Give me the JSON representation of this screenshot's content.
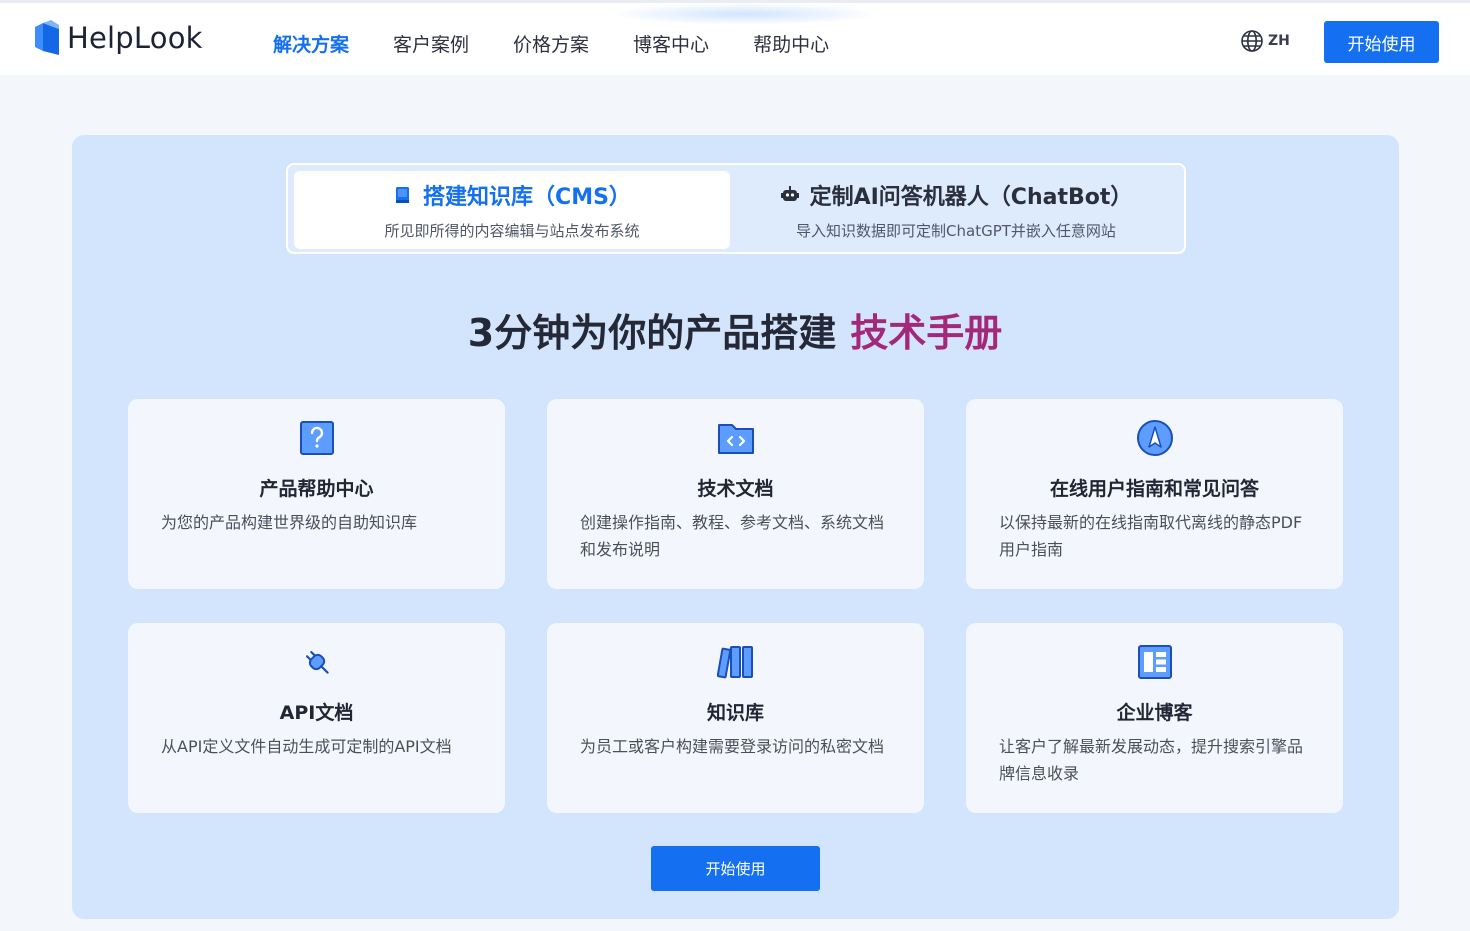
{
  "header": {
    "logo_text": "HelpLook",
    "nav": [
      {
        "label": "解决方案",
        "active": true
      },
      {
        "label": "客户案例",
        "active": false
      },
      {
        "label": "价格方案",
        "active": false
      },
      {
        "label": "博客中心",
        "active": false
      },
      {
        "label": "帮助中心",
        "active": false
      }
    ],
    "lang_label": "ZH",
    "cta_label": "开始使用"
  },
  "tabs": [
    {
      "title": "搭建知识库（CMS）",
      "subtitle": "所见即所得的内容编辑与站点发布系统",
      "icon": "book-icon",
      "active": true
    },
    {
      "title": "定制AI问答机器人（ChatBot）",
      "subtitle": "导入知识数据即可定制ChatGPT并嵌入任意网站",
      "icon": "robot-icon",
      "active": false
    }
  ],
  "headline": {
    "main": "3分钟为你的产品搭建",
    "accent": "技术手册"
  },
  "cards": [
    {
      "title": "产品帮助中心",
      "desc": "为您的产品构建世界级的自助知识库",
      "icon": "question-icon"
    },
    {
      "title": "技术文档",
      "desc": "创建操作指南、教程、参考文档、系统文档和发布说明",
      "icon": "code-folder-icon"
    },
    {
      "title": "在线用户指南和常见问答",
      "desc": "以保持最新的在线指南取代离线的静态PDF用户指南",
      "icon": "compass-icon"
    },
    {
      "title": "API文档",
      "desc": "从API定义文件自动生成可定制的API文档",
      "icon": "plug-icon"
    },
    {
      "title": "知识库",
      "desc": "为员工或客户构建需要登录访问的私密文档",
      "icon": "library-icon"
    },
    {
      "title": "企业博客",
      "desc": "让客户了解最新发展动态，提升搜索引擎品牌信息收录",
      "icon": "blog-layout-icon"
    }
  ],
  "bottom_cta_label": "开始使用",
  "colors": {
    "brand": "#1470f0",
    "accent": "#a3287a",
    "panel": "#d3e5fc",
    "card": "#f3f7fd"
  }
}
